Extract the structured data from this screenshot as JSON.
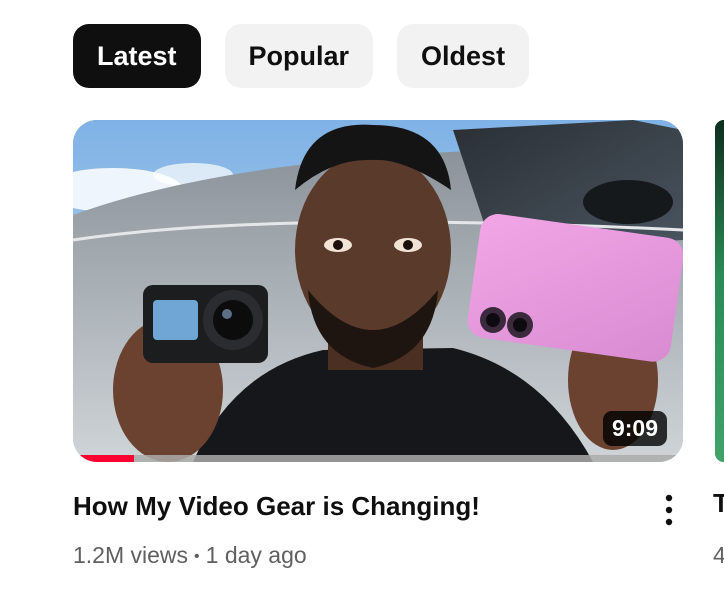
{
  "filters": [
    {
      "label": "Latest",
      "active": true
    },
    {
      "label": "Popular",
      "active": false
    },
    {
      "label": "Oldest",
      "active": false
    }
  ],
  "video": {
    "title": "How My Video Gear is Changing!",
    "views": "1.2M views",
    "separator": "•",
    "age": "1 day ago",
    "duration": "9:09",
    "watch_progress_fraction": 0.1,
    "thumbnail_icon": "person-holding-camera-and-phone-thumbnail"
  },
  "next_video": {
    "title_fragment": "T",
    "meta_fragment": "4"
  },
  "icons": {
    "more": "more-vert-icon"
  },
  "colors": {
    "chip_active_bg": "#0f0f0f",
    "chip_bg": "#f2f2f2",
    "progress": "#ff0033",
    "meta_text": "#606060"
  }
}
